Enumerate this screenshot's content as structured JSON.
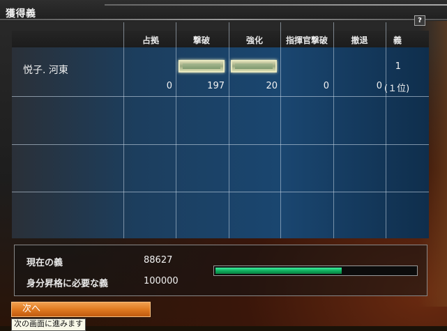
{
  "window": {
    "title": "獲得義",
    "help_label": "?"
  },
  "table": {
    "columns": [
      "占拠",
      "撃破",
      "強化",
      "指揮官撃破",
      "撤退",
      "義"
    ],
    "row": {
      "name": "悦子. 河東",
      "rank_value": "1",
      "values": [
        "0",
        "197",
        "20",
        "0",
        "0"
      ],
      "rank_text": "(１位)"
    }
  },
  "status": {
    "current_label": "現在の義",
    "current_value": "88627",
    "required_label": "身分昇格に必要な義",
    "required_value": "100000",
    "progress_fraction": 0.63
  },
  "footer": {
    "next_label": "次へ",
    "tooltip": "次の画面に進みます"
  },
  "colors": {
    "gauge": "#10b060",
    "button": "#e07a20",
    "panel": "#1a4670"
  }
}
